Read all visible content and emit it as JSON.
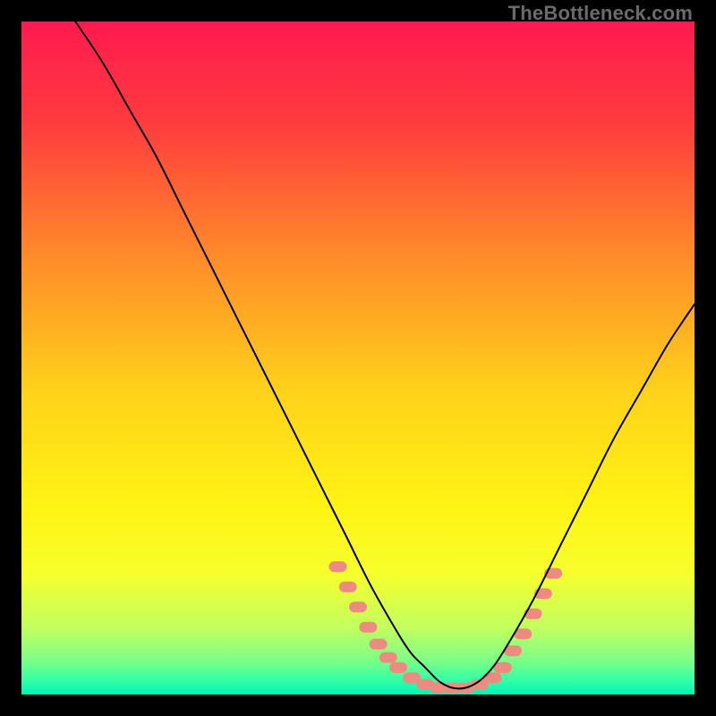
{
  "watermark": "TheBottleneck.com",
  "chart_data": {
    "type": "line",
    "title": "",
    "xlabel": "",
    "ylabel": "",
    "xlim": [
      0,
      100
    ],
    "ylim": [
      0,
      100
    ],
    "grid": false,
    "background_gradient": {
      "type": "vertical",
      "stops": [
        {
          "offset": 0.0,
          "color": "#ff1a50"
        },
        {
          "offset": 0.15,
          "color": "#ff3b3e"
        },
        {
          "offset": 0.35,
          "color": "#ff8b2a"
        },
        {
          "offset": 0.55,
          "color": "#ffd21a"
        },
        {
          "offset": 0.72,
          "color": "#fff314"
        },
        {
          "offset": 0.82,
          "color": "#f6ff2c"
        },
        {
          "offset": 0.9,
          "color": "#c3ff5e"
        },
        {
          "offset": 0.95,
          "color": "#7bff88"
        },
        {
          "offset": 0.98,
          "color": "#2effa8"
        },
        {
          "offset": 1.0,
          "color": "#00f5b6"
        }
      ]
    },
    "series": [
      {
        "name": "bottleneck-curve",
        "color": "#000000",
        "x": [
          8,
          12,
          16,
          20,
          24,
          28,
          32,
          36,
          40,
          44,
          48,
          52,
          56,
          58,
          60,
          62,
          64,
          66,
          68,
          70,
          72,
          76,
          80,
          84,
          88,
          92,
          96,
          100
        ],
        "y": [
          100,
          94,
          87,
          80,
          72,
          64,
          56,
          48,
          40,
          32,
          24,
          16,
          9,
          6,
          4,
          2,
          1,
          1,
          2,
          4,
          7,
          14,
          22,
          30,
          38,
          45,
          52,
          58
        ]
      }
    ],
    "markers": [
      {
        "name": "highlight-region",
        "color": "#ee8b81",
        "shape": "rounded-rect",
        "points": [
          {
            "x": 47.0,
            "y": 19.0
          },
          {
            "x": 48.5,
            "y": 16.0
          },
          {
            "x": 50.0,
            "y": 13.0
          },
          {
            "x": 51.5,
            "y": 10.0
          },
          {
            "x": 53.0,
            "y": 7.5
          },
          {
            "x": 54.5,
            "y": 5.5
          },
          {
            "x": 56.0,
            "y": 4.0
          },
          {
            "x": 58.0,
            "y": 2.5
          },
          {
            "x": 60.0,
            "y": 1.5
          },
          {
            "x": 62.0,
            "y": 1.0
          },
          {
            "x": 64.0,
            "y": 1.0
          },
          {
            "x": 66.0,
            "y": 1.0
          },
          {
            "x": 68.0,
            "y": 1.5
          },
          {
            "x": 70.0,
            "y": 2.5
          },
          {
            "x": 71.5,
            "y": 4.0
          },
          {
            "x": 73.0,
            "y": 6.5
          },
          {
            "x": 74.5,
            "y": 9.0
          },
          {
            "x": 76.0,
            "y": 12.0
          },
          {
            "x": 77.5,
            "y": 15.0
          },
          {
            "x": 79.0,
            "y": 18.0
          }
        ]
      }
    ]
  }
}
